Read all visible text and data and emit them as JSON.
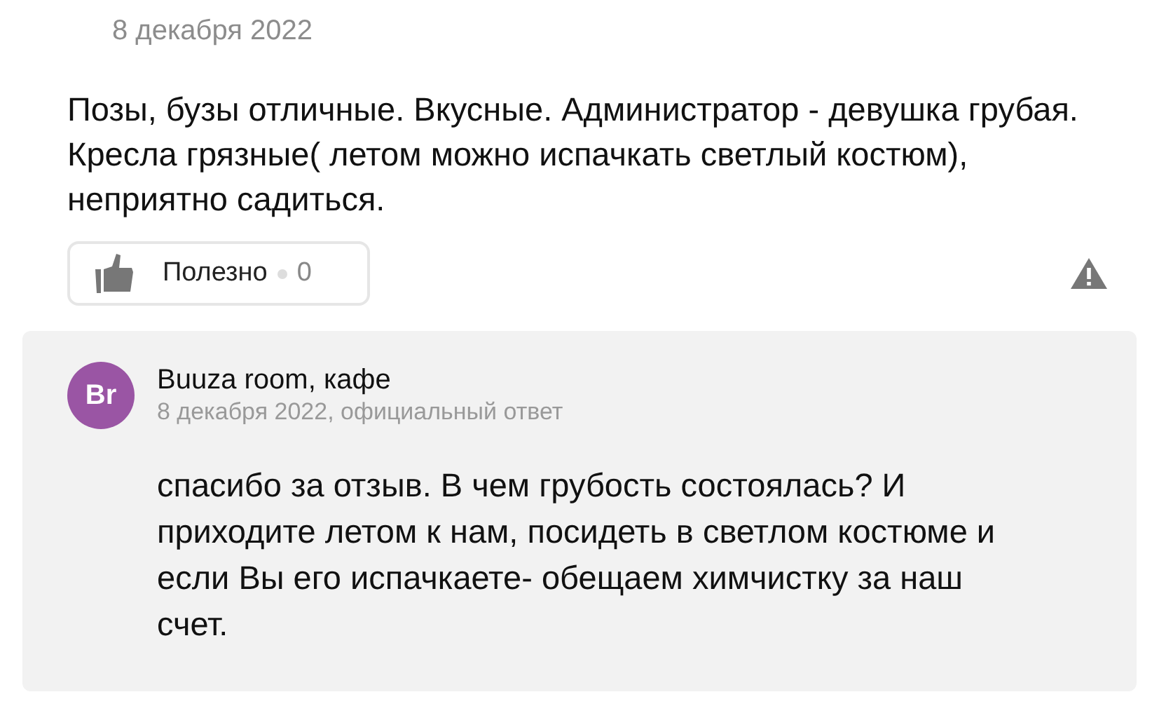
{
  "review": {
    "date": "8 декабря 2022",
    "text": "Позы, бузы отличные. Вкусные. Администратор - девушка грубая. Кресла грязные( летом можно испачкать светлый костюм), неприятно садиться.",
    "useful_button": {
      "label": "Полезно",
      "count": "0"
    }
  },
  "reply": {
    "avatar": {
      "initials": "Br",
      "color": "#9a55a4"
    },
    "author": "Buuza room, кафе",
    "meta": "8 декабря 2022, официальный ответ",
    "text": "спасибо за отзыв. В чем грубость состоялась? И приходите летом к нам, посидеть в светлом костюме и если Вы его испачкаете- обещаем химчистку за наш счет."
  }
}
